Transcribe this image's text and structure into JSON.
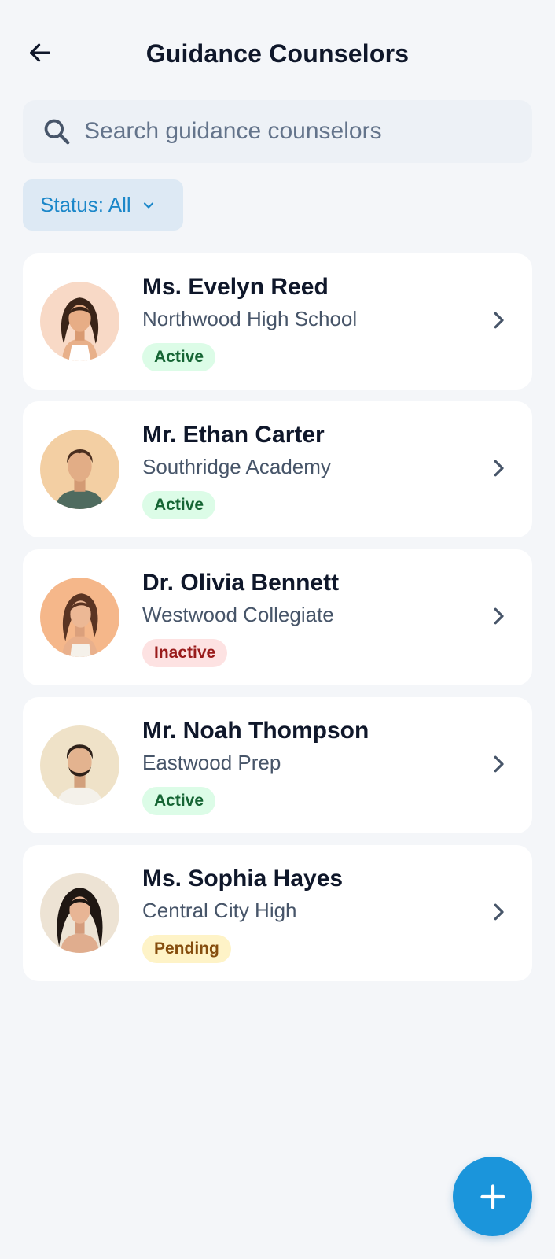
{
  "header": {
    "title": "Guidance Counselors",
    "back_icon": "arrow-left-icon"
  },
  "search": {
    "placeholder": "Search guidance counselors",
    "value": "",
    "icon": "search-icon"
  },
  "filter": {
    "label": "Status: All",
    "icon": "chevron-down-icon"
  },
  "counselors": [
    {
      "name": "Ms. Evelyn Reed",
      "school": "Northwood High School",
      "status": "Active"
    },
    {
      "name": "Mr. Ethan Carter",
      "school": "Southridge Academy",
      "status": "Active"
    },
    {
      "name": "Dr. Olivia Bennett",
      "school": "Westwood Collegiate",
      "status": "Inactive"
    },
    {
      "name": "Mr. Noah Thompson",
      "school": "Eastwood Prep",
      "status": "Active"
    },
    {
      "name": "Ms. Sophia Hayes",
      "school": "Central City High",
      "status": "Pending"
    }
  ],
  "fab": {
    "icon": "plus-icon"
  },
  "colors": {
    "accent": "#1b95db",
    "active_bg": "#dcfce7",
    "inactive_bg": "#fde2e2",
    "pending_bg": "#fef3c7"
  }
}
